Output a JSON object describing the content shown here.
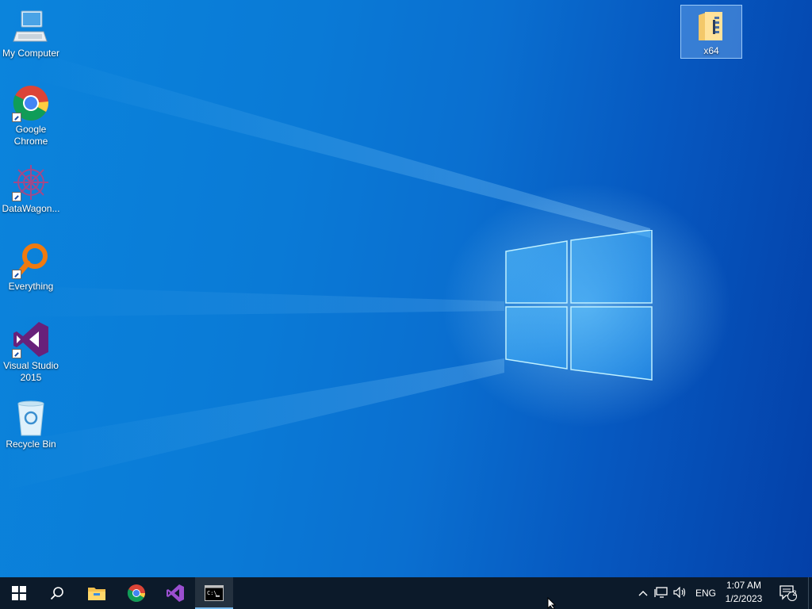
{
  "desktop": {
    "icons": [
      {
        "label": "My Computer",
        "icon": "computer-icon",
        "shortcut": false
      },
      {
        "label": "Google Chrome",
        "icon": "chrome-icon",
        "shortcut": true
      },
      {
        "label": "DataWagon...",
        "icon": "datawagon-icon",
        "shortcut": true
      },
      {
        "label": "Everything",
        "icon": "everything-search-icon",
        "shortcut": true
      },
      {
        "label": "Visual Studio 2015",
        "icon": "visual-studio-icon",
        "shortcut": true
      },
      {
        "label": "Recycle Bin",
        "icon": "recycle-bin-icon",
        "shortcut": false
      }
    ],
    "selected_item": {
      "label": "x64",
      "icon": "zip-folder-icon"
    }
  },
  "taskbar": {
    "buttons": [
      {
        "name": "start",
        "icon": "windows-start-icon"
      },
      {
        "name": "search",
        "icon": "search-icon"
      },
      {
        "name": "file-explorer",
        "icon": "file-explorer-icon"
      },
      {
        "name": "chrome",
        "icon": "chrome-icon"
      },
      {
        "name": "visual-studio",
        "icon": "visual-studio-icon"
      },
      {
        "name": "command-prompt",
        "icon": "cmd-icon",
        "active": true
      }
    ],
    "tray": {
      "language": "ENG",
      "time": "1:07 AM",
      "date": "1/2/2023",
      "notification_count": "2"
    }
  },
  "colors": {
    "taskbar_bg": "#0c1a2a",
    "desktop_blue": "#0a7ad6",
    "active_indicator": "#76b9ed"
  }
}
